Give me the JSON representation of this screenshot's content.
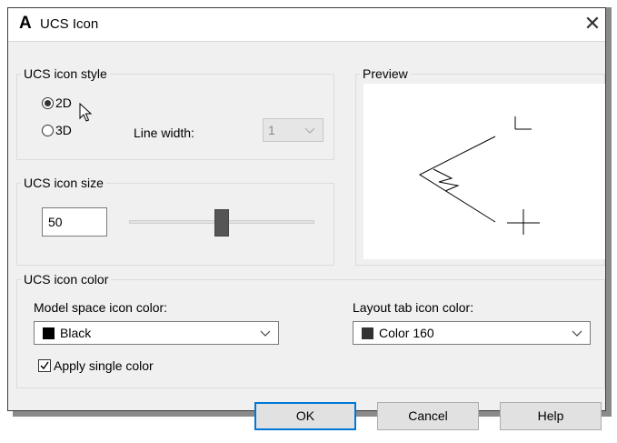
{
  "window": {
    "logo_letter": "A",
    "title": "UCS Icon"
  },
  "style_group": {
    "legend": "UCS icon style",
    "radio_2d": "2D",
    "radio_3d": "3D",
    "selected": "2D",
    "line_width_label": "Line width:",
    "line_width_value": "1"
  },
  "preview_group": {
    "legend": "Preview"
  },
  "size_group": {
    "legend": "UCS icon size",
    "value": "50",
    "slider_fraction": 0.5
  },
  "color_group": {
    "legend": "UCS icon color",
    "model_label": "Model space icon color:",
    "model_value": "Black",
    "model_swatch": "#000000",
    "layout_label": "Layout tab icon color:",
    "layout_value": "Color 160",
    "layout_swatch": "#333333",
    "apply_single": "Apply single color",
    "apply_single_checked": true
  },
  "buttons": {
    "ok": "OK",
    "cancel": "Cancel",
    "help": "Help"
  },
  "colors": {
    "accent": "#0078d7",
    "dialog_bg": "#f0f0f0"
  }
}
